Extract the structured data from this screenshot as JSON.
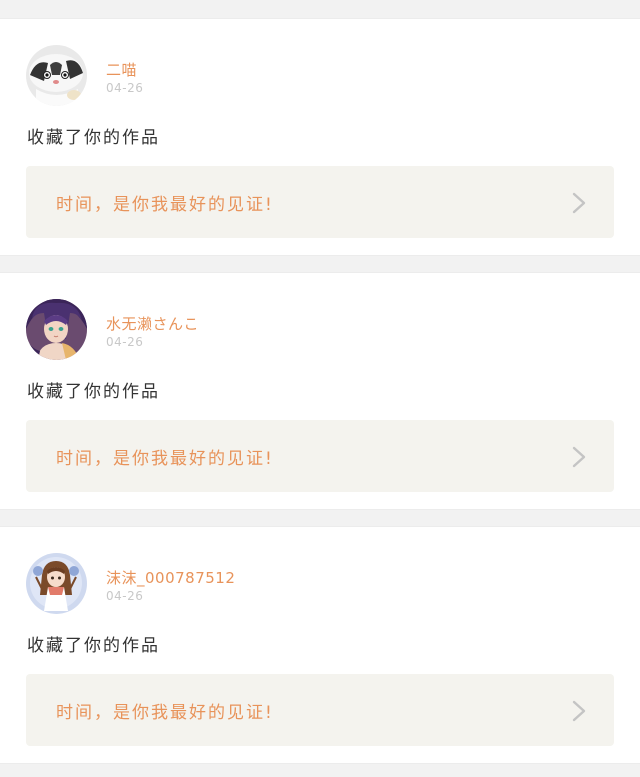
{
  "feed": {
    "items": [
      {
        "username": "二喵",
        "date": "04-26",
        "action": "收藏了你的作品",
        "quote": "时间，是你我最好的见证!",
        "avatar_icon": "cat-avatar-icon"
      },
      {
        "username": "水无濑さんこ",
        "date": "04-26",
        "action": "收藏了你的作品",
        "quote": "时间，是你我最好的见证!",
        "avatar_icon": "anime-girl-avatar-icon"
      },
      {
        "username": "沫沫_000787512",
        "date": "04-26",
        "action": "收藏了你的作品",
        "quote": "时间，是你我最好的见证!",
        "avatar_icon": "chibi-girl-avatar-icon"
      }
    ]
  },
  "colors": {
    "accent": "#e8935a",
    "action_text": "#333333",
    "date_text": "#c8c8c8",
    "quote_bg": "#f4f3ee",
    "page_bg": "#f2f2f2",
    "chevron": "#c4c4c4"
  }
}
